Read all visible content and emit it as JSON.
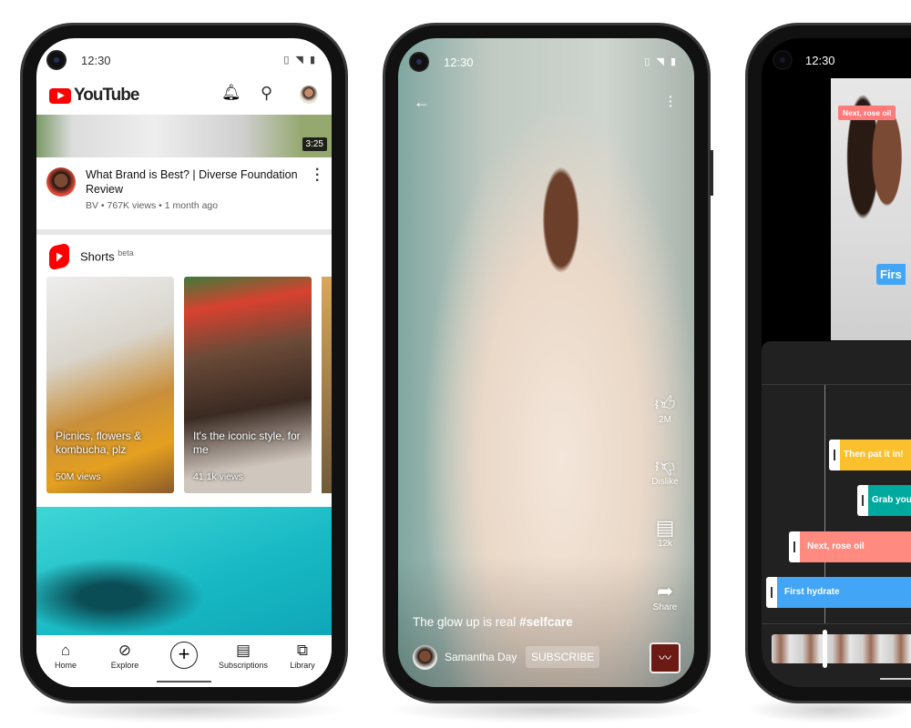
{
  "phone1": {
    "status_time": "12:30",
    "brand": "YouTube",
    "header_icons": [
      "bell-icon",
      "search-icon",
      "avatar"
    ],
    "video": {
      "duration": "3:25",
      "title": "What Brand is Best? | Diverse Foundation Review",
      "channel": "BV",
      "meta": "767K views • 1 month ago"
    },
    "shorts": {
      "title": "Shorts",
      "badge": "beta",
      "items": [
        {
          "title": "Picnics, flowers & kombucha, plz",
          "views": "50M views"
        },
        {
          "title": "It's the iconic style, for me",
          "views": "41.1k views"
        }
      ]
    },
    "nav": [
      {
        "label": "Home",
        "icon": "home-icon"
      },
      {
        "label": "Explore",
        "icon": "compass-icon"
      },
      {
        "label": "",
        "icon": "create-plus-icon"
      },
      {
        "label": "Subscriptions",
        "icon": "subscriptions-icon"
      },
      {
        "label": "Library",
        "icon": "library-icon"
      }
    ],
    "colors": {
      "brand_red": "#ff0000"
    }
  },
  "phone2": {
    "status_time": "12:30",
    "actions": [
      {
        "icon": "thumb-up-icon",
        "label": "2M"
      },
      {
        "icon": "thumb-down-icon",
        "label": "Dislike"
      },
      {
        "icon": "comment-icon",
        "label": "12k"
      },
      {
        "icon": "share-icon",
        "label": "Share"
      }
    ],
    "caption": "The glow up is real ",
    "hashtag": "#selfcare",
    "channel": "Samantha Day",
    "subscribe": "SUBSCRIBE"
  },
  "phone3": {
    "status_time": "12:30",
    "overlay_label": "Next, rose oil",
    "overlay_caption": "Firs",
    "tracks": [
      {
        "label": "Then pat it in!",
        "color": "#fbc02d"
      },
      {
        "label": "Grab you",
        "color": "#00a99d"
      },
      {
        "label": "Next, rose oil",
        "color": "#ff8a80"
      },
      {
        "label": "First hydrate",
        "color": "#42a5f5"
      }
    ]
  }
}
